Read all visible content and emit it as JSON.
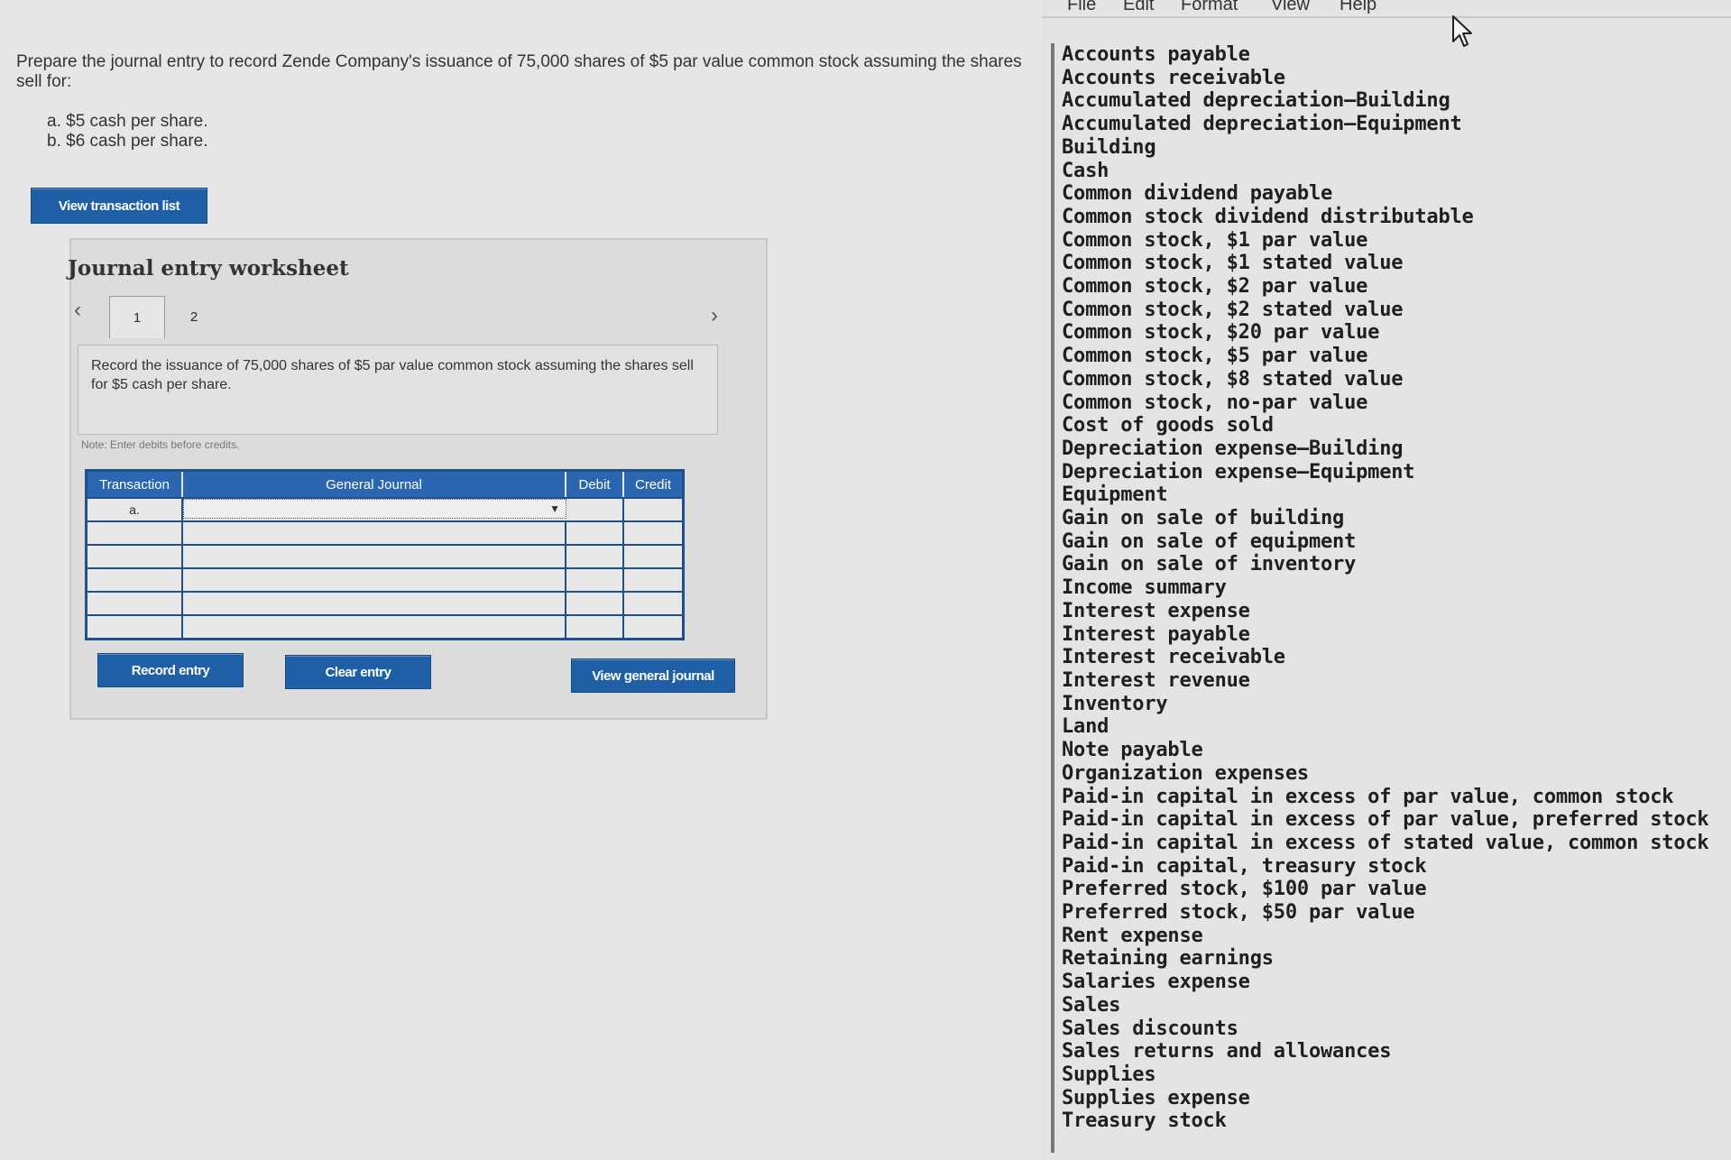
{
  "question": {
    "prompt": "Prepare the journal entry to record Zende Company's issuance of 75,000 shares of $5 par value common stock assuming the shares sell for:",
    "options": [
      "a. $5 cash per share.",
      "b. $6 cash per share."
    ]
  },
  "buttons": {
    "view_transaction_list": "View transaction list",
    "record_entry": "Record entry",
    "clear_entry": "Clear entry",
    "view_general_journal": "View general journal"
  },
  "worksheet": {
    "title": "Journal entry worksheet",
    "tabs": [
      "1",
      "2"
    ],
    "instruction": "Record the issuance of 75,000 shares of $5 par value common stock assuming the shares sell for $5 cash per share.",
    "note": "Note: Enter debits before credits.",
    "journal": {
      "headers": [
        "Transaction",
        "General Journal",
        "Debit",
        "Credit"
      ],
      "rows": [
        "a.",
        "",
        "",
        "",
        "",
        ""
      ]
    }
  },
  "menubar": [
    "File",
    "Edit",
    "Format",
    "View",
    "Help"
  ],
  "accounts": [
    "Accounts payable",
    "Accounts receivable",
    "Accumulated depreciation—Building",
    "Accumulated depreciation—Equipment",
    "Building",
    "Cash",
    "Common dividend payable",
    "Common stock dividend distributable",
    "Common stock, $1 par value",
    "Common stock, $1 stated value",
    "Common stock, $2 par value",
    "Common stock, $2 stated value",
    "Common stock, $20 par value",
    "Common stock, $5 par value",
    "Common stock, $8 stated value",
    "Common stock, no-par value",
    "Cost of goods sold",
    "Depreciation expense—Building",
    "Depreciation expense—Equipment",
    "Equipment",
    "Gain on sale of building",
    "Gain on sale of equipment",
    "Gain on sale of inventory",
    "Income summary",
    "Interest expense",
    "Interest payable",
    "Interest receivable",
    "Interest revenue",
    "Inventory",
    "Land",
    "Note payable",
    "Organization expenses",
    "Paid-in capital in excess of par value, common stock",
    "Paid-in capital in excess of par value, preferred stock",
    "Paid-in capital in excess of stated value, common stock",
    "Paid-in capital, treasury stock",
    "Preferred stock, $100 par value",
    "Preferred stock, $50 par value",
    "Rent expense",
    "Retaining earnings",
    "Salaries expense",
    "Sales",
    "Sales discounts",
    "Sales returns and allowances",
    "Supplies",
    "Supplies expense",
    "Treasury stock"
  ]
}
